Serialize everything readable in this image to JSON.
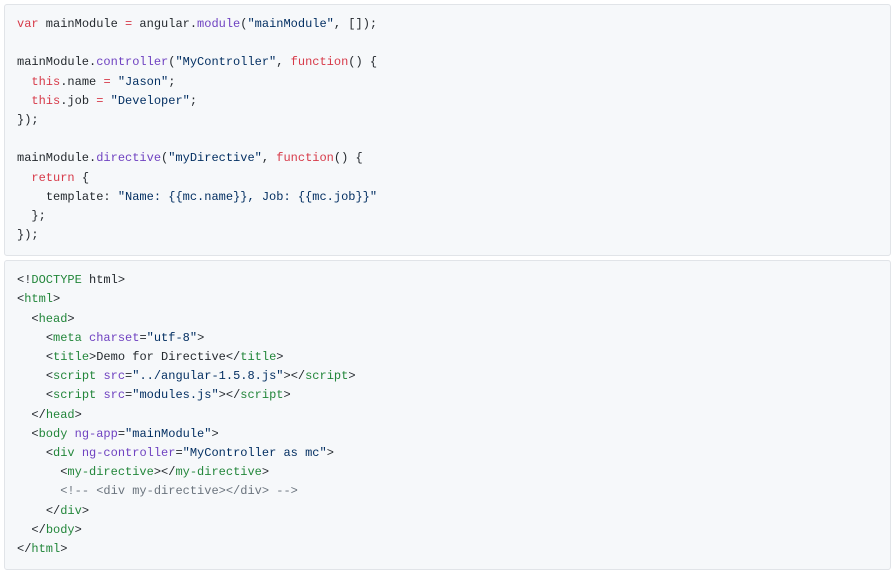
{
  "block1": {
    "l1": {
      "var": "var",
      "main": " mainModule ",
      "eq": "=",
      "angular": " angular.",
      "module": "module",
      "paren": "(",
      "str": "\"mainModule\"",
      "rest": ", []);"
    },
    "l2": "",
    "l3": {
      "pre": "mainModule.",
      "fn": "controller",
      "paren": "(",
      "str": "\"MyController\"",
      "comma": ", ",
      "kw": "function",
      "rest": "() {"
    },
    "l4": {
      "indent": "  ",
      "this": "this",
      "dot": ".name ",
      "eq": "=",
      "sp": " ",
      "str": "\"Jason\"",
      "semi": ";"
    },
    "l5": {
      "indent": "  ",
      "this": "this",
      "dot": ".job ",
      "eq": "=",
      "sp": " ",
      "str": "\"Developer\"",
      "semi": ";"
    },
    "l6": "});",
    "l7": "",
    "l8": {
      "pre": "mainModule.",
      "fn": "directive",
      "paren": "(",
      "str": "\"myDirective\"",
      "comma": ", ",
      "kw": "function",
      "rest": "() {"
    },
    "l9": {
      "indent": "  ",
      "kw": "return",
      "rest": " {"
    },
    "l10": {
      "indent": "    ",
      "key": "template",
      "colon": ": ",
      "str": "\"Name: {{mc.name}}, Job: {{mc.job}}\""
    },
    "l11": "  };",
    "l12": "});"
  },
  "block2": {
    "l1": {
      "open": "<!",
      "name": "DOCTYPE",
      "rest": " html",
      "close": ">"
    },
    "l2": {
      "open": "<",
      "tag": "html",
      "close": ">"
    },
    "l3": {
      "indent": "  ",
      "open": "<",
      "tag": "head",
      "close": ">"
    },
    "l4": {
      "indent": "    ",
      "open": "<",
      "tag": "meta",
      "sp": " ",
      "attr": "charset",
      "eq": "=",
      "val": "\"utf-8\"",
      "close": ">"
    },
    "l5": {
      "indent": "    ",
      "open": "<",
      "tag": "title",
      "close": ">",
      "text": "Demo for Directive",
      "open2": "</",
      "tag2": "title",
      "close2": ">"
    },
    "l6": {
      "indent": "    ",
      "open": "<",
      "tag": "script",
      "sp": " ",
      "attr": "src",
      "eq": "=",
      "val": "\"../angular-1.5.8.js\"",
      "close": ">",
      "open2": "</",
      "tag2": "script",
      "close2": ">"
    },
    "l7": {
      "indent": "    ",
      "open": "<",
      "tag": "script",
      "sp": " ",
      "attr": "src",
      "eq": "=",
      "val": "\"modules.js\"",
      "close": ">",
      "open2": "</",
      "tag2": "script",
      "close2": ">"
    },
    "l8": {
      "indent": "  ",
      "open": "</",
      "tag": "head",
      "close": ">"
    },
    "l9": {
      "indent": "  ",
      "open": "<",
      "tag": "body",
      "sp": " ",
      "attr": "ng-app",
      "eq": "=",
      "val": "\"mainModule\"",
      "close": ">"
    },
    "l10": {
      "indent": "    ",
      "open": "<",
      "tag": "div",
      "sp": " ",
      "attr": "ng-controller",
      "eq": "=",
      "val": "\"MyController as mc\"",
      "close": ">"
    },
    "l11": {
      "indent": "      ",
      "open": "<",
      "tag": "my-directive",
      "close": ">",
      "open2": "</",
      "tag2": "my-directive",
      "close2": ">"
    },
    "l12": {
      "indent": "      ",
      "cmt": "<!-- <div my-directive></div> -->"
    },
    "l13": {
      "indent": "    ",
      "open": "</",
      "tag": "div",
      "close": ">"
    },
    "l14": {
      "indent": "  ",
      "open": "</",
      "tag": "body",
      "close": ">"
    },
    "l15": {
      "open": "</",
      "tag": "html",
      "close": ">"
    }
  }
}
